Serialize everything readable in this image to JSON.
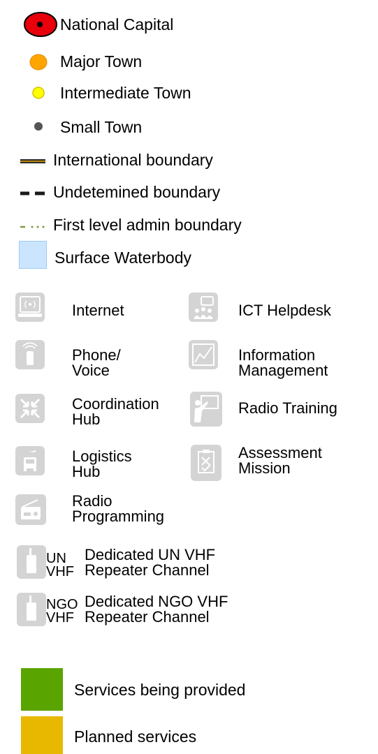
{
  "legend": {
    "settlements": [
      {
        "label": "National Capital",
        "icon": "national-capital-icon",
        "fill": "#e8000b"
      },
      {
        "label": "Major Town",
        "icon": "major-town-icon",
        "fill": "#ffa500"
      },
      {
        "label": "Intermediate Town",
        "icon": "intermediate-town-icon",
        "fill": "#ffff00"
      },
      {
        "label": "Small Town",
        "icon": "small-town-icon",
        "fill": "#555555"
      }
    ],
    "boundaries": [
      {
        "label": "International boundary",
        "icon": "international-boundary-line"
      },
      {
        "label": "Undetemined boundary",
        "icon": "undetermined-boundary-line"
      },
      {
        "label": "First level admin boundary",
        "icon": "admin-boundary-line"
      }
    ],
    "water": {
      "label": "Surface Waterbody",
      "fill": "#cce5ff"
    }
  },
  "services": [
    {
      "label": "Internet",
      "icon": "internet-icon"
    },
    {
      "label": "ICT Helpdesk",
      "icon": "ict-helpdesk-icon"
    },
    {
      "label": "Phone/\nVoice",
      "icon": "phone-voice-icon"
    },
    {
      "label": "Information\nManagement",
      "icon": "information-management-icon"
    },
    {
      "label": "Coordination\nHub",
      "icon": "coordination-hub-icon"
    },
    {
      "label": "Radio Training",
      "icon": "radio-training-icon"
    },
    {
      "label": "Logistics\nHub",
      "icon": "logistics-hub-icon"
    },
    {
      "label": "Assessment\nMission",
      "icon": "assessment-mission-icon"
    },
    {
      "label": "Radio\nProgramming",
      "icon": "radio-programming-icon"
    }
  ],
  "repeaters": [
    {
      "badge": "UN\nVHF",
      "label": "Dedicated UN VHF\nRepeater Channel",
      "icon": "handheld-radio-icon"
    },
    {
      "badge": "NGO\nVHF",
      "label": "Dedicated NGO VHF\nRepeater Channel",
      "icon": "handheld-radio-icon"
    }
  ],
  "status": [
    {
      "label": "Services being provided",
      "color": "#5aa400"
    },
    {
      "label": "Planned services",
      "color": "#e8b800"
    }
  ]
}
